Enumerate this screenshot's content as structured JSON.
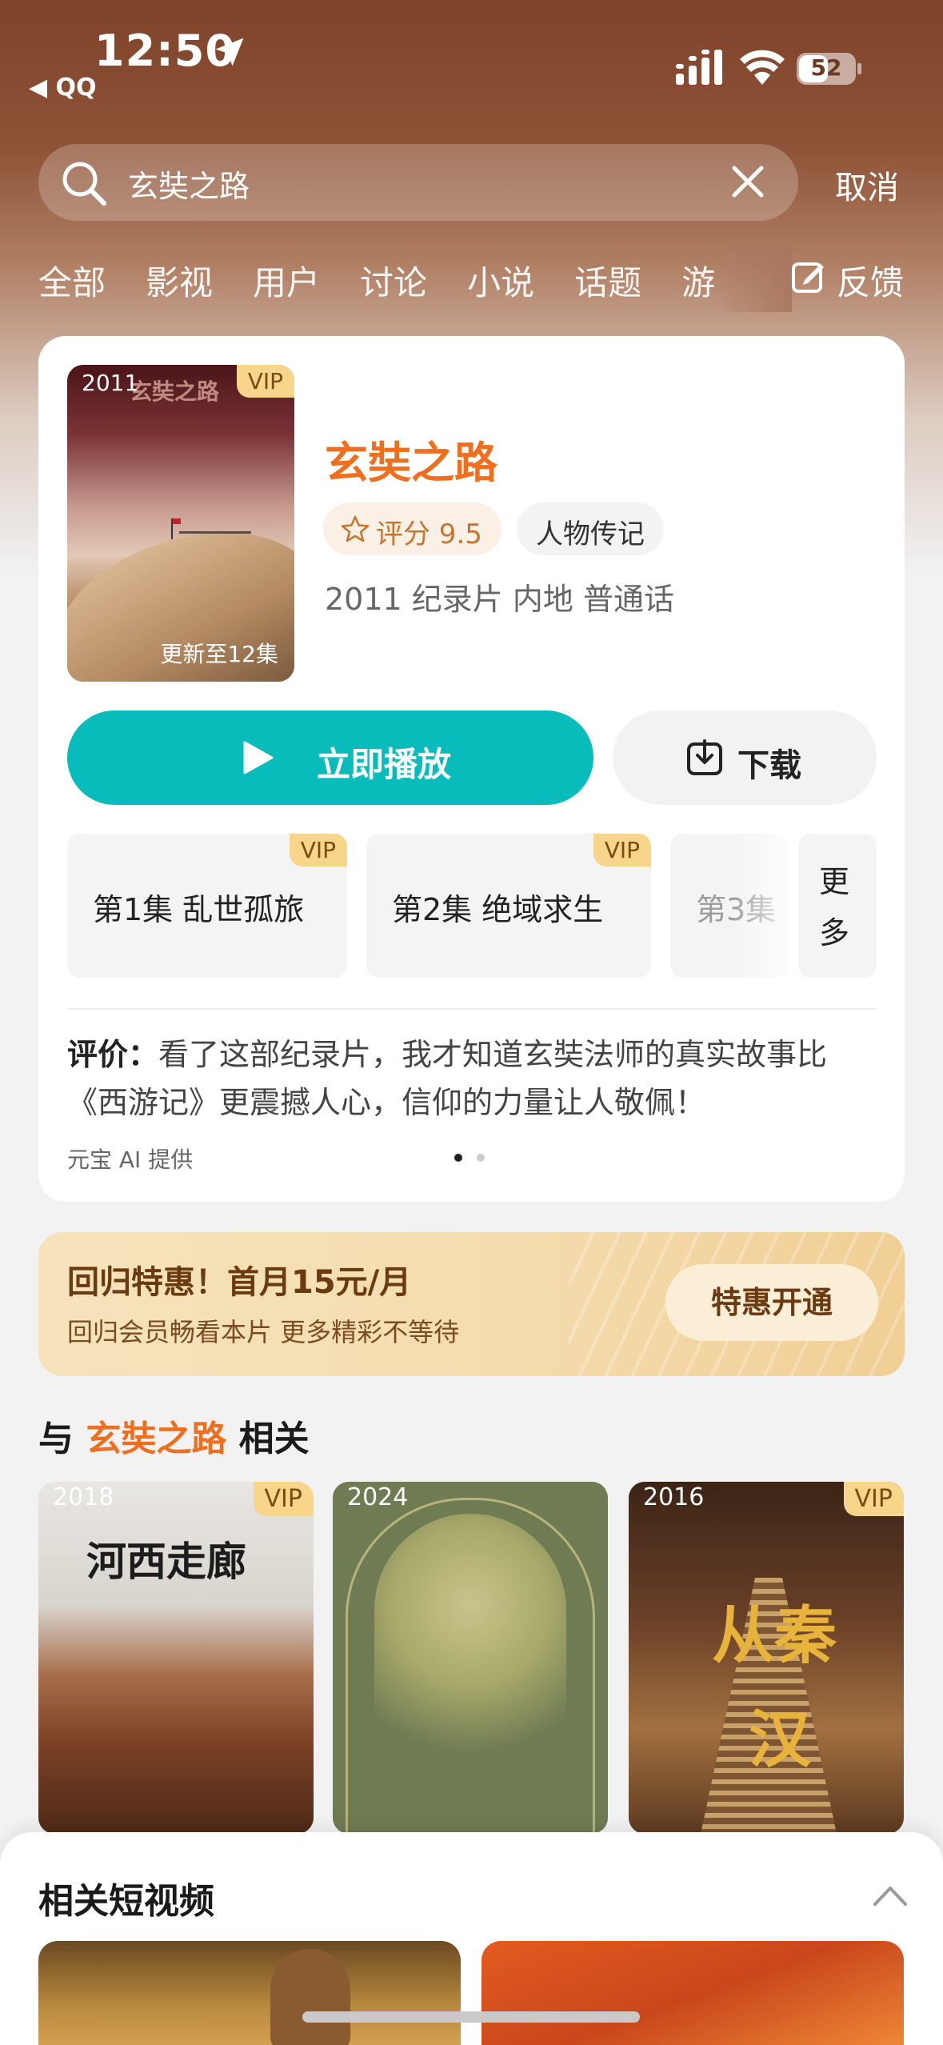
{
  "status_bar": {
    "time": "12:50",
    "back_app": "◀ QQ",
    "battery": "52"
  },
  "search": {
    "query": "玄奘之路",
    "cancel_label": "取消"
  },
  "tabs": [
    "全部",
    "影视",
    "用户",
    "讨论",
    "小说",
    "话题",
    "游"
  ],
  "feedback_label": "反馈",
  "result": {
    "year_badge": "2011",
    "vip_badge": "VIP",
    "poster_title": "玄奘之路",
    "update_text": "更新至12集",
    "title": "玄奘之路",
    "score_label": "评分 9.5",
    "genre": "人物传记",
    "meta": "2011 纪录片 内地 普通话",
    "play_label": "立即播放",
    "download_label": "下载",
    "episodes": [
      {
        "label": "第1集 乱世孤旅",
        "vip": "VIP"
      },
      {
        "label": "第2集 绝域求生",
        "vip": "VIP"
      },
      {
        "label": "第3集"
      }
    ],
    "more_label": "更多",
    "review_prefix": "评价：",
    "review_text": "看了这部纪录片，我才知道玄奘法师的真实故事比《西游记》更震撼人心，信仰的力量让人敬佩！",
    "provider": "元宝 AI 提供",
    "page_dots": {
      "count": 2,
      "active": 1
    }
  },
  "promo": {
    "headline": "回归特惠！首月15元/月",
    "sub": "回归会员畅看本片 更多精彩不等待",
    "button": "特惠开通"
  },
  "related": {
    "prefix": "与",
    "keyword": "玄奘之路",
    "suffix": "相关",
    "items": [
      {
        "year": "2018",
        "vip": "VIP",
        "poster_text": "河西走廊"
      },
      {
        "year": "2024"
      },
      {
        "year": "2016",
        "vip": "VIP",
        "poster_text_1": "从秦",
        "poster_text_2": "汉"
      }
    ]
  },
  "sheet": {
    "title": "相关短视频"
  },
  "colors": {
    "accent_orange": "#ef6f1e",
    "play_teal": "#07bcba",
    "vip_gold": "#f7d58a",
    "header_brown": "#7e432a"
  }
}
